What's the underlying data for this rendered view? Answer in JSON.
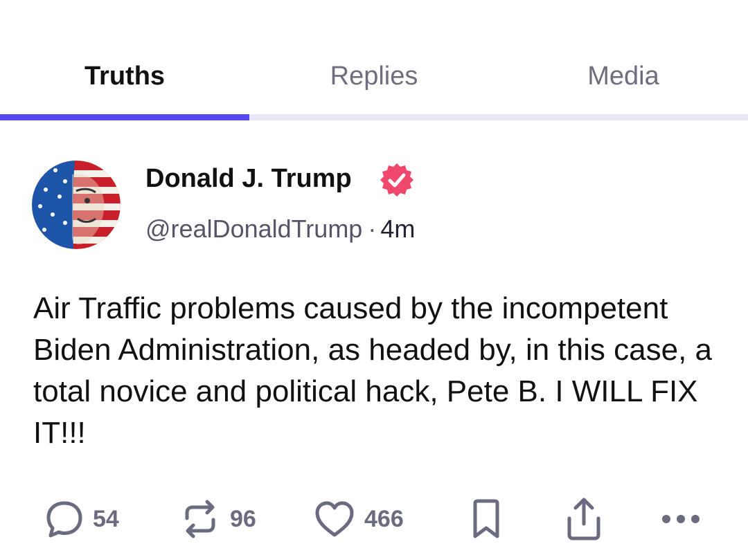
{
  "tabs": [
    {
      "label": "Truths",
      "active": true
    },
    {
      "label": "Replies",
      "active": false
    },
    {
      "label": "Media",
      "active": false
    }
  ],
  "colors": {
    "accent": "#5448ee",
    "verified_badge": "#f0486c",
    "muted_text": "#6a6a80"
  },
  "post": {
    "author_name": "Donald J. Trump",
    "handle": "@realDonaldTrump",
    "separator": "·",
    "time": "4m",
    "verified": true,
    "text": "Air Traffic problems caused by the incompetent Biden Administration, as headed by, in this case, a total novice and political hack, Pete B. I WILL FIX IT!!!",
    "avatar_icon": "flag-portrait-avatar"
  },
  "actions": {
    "replies": {
      "icon": "comment-icon",
      "count": "54"
    },
    "retruths": {
      "icon": "repost-icon",
      "count": "96"
    },
    "likes": {
      "icon": "heart-icon",
      "count": "466"
    },
    "bookmark": {
      "icon": "bookmark-icon"
    },
    "share": {
      "icon": "share-icon"
    },
    "more": {
      "icon": "more-icon"
    }
  }
}
